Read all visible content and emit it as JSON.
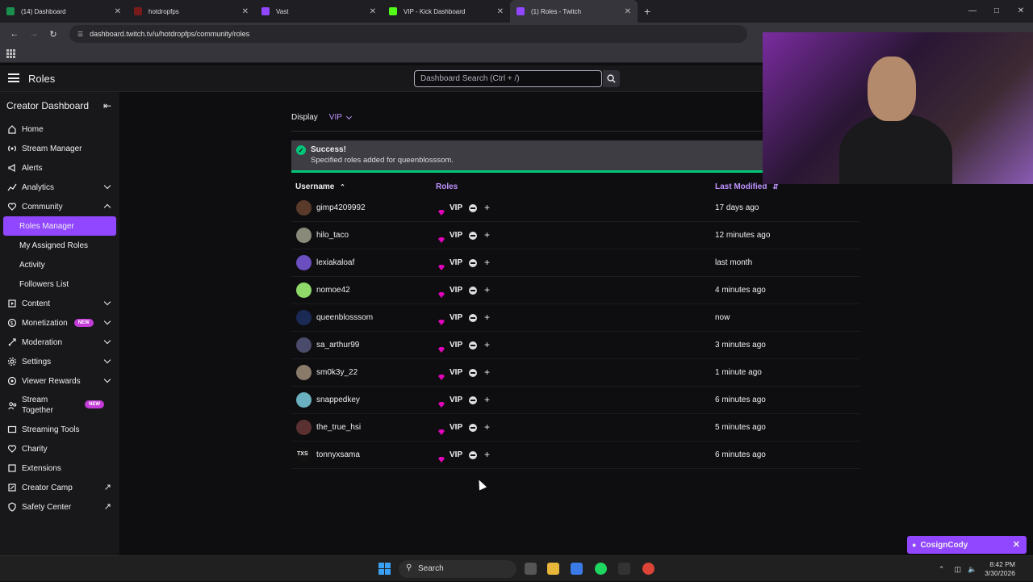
{
  "browser": {
    "tabs": [
      {
        "title": "(14) Dashboard",
        "favicon_color": "#1a8f4d",
        "active": false
      },
      {
        "title": "hotdropfps",
        "favicon_color": "#7a1b1b",
        "active": false
      },
      {
        "title": "Vast",
        "favicon_color": "#9147ff",
        "active": false
      },
      {
        "title": "VIP - Kick Dashboard",
        "favicon_color": "#53fc18",
        "active": false
      },
      {
        "title": "(1) Roles - Twitch",
        "favicon_color": "#9147ff",
        "active": true
      }
    ],
    "url": "dashboard.twitch.tv/u/hotdropfps/community/roles"
  },
  "topnav": {
    "title": "Roles",
    "search_placeholder": "Dashboard Search (Ctrl + /)"
  },
  "sidebar": {
    "header": "Creator Dashboard",
    "items": [
      {
        "label": "Home",
        "icon": "home-icon"
      },
      {
        "label": "Stream Manager",
        "icon": "broadcast-icon"
      },
      {
        "label": "Alerts",
        "icon": "megaphone-icon"
      },
      {
        "label": "Analytics",
        "icon": "chart-icon"
      },
      {
        "label": "Community",
        "icon": "heart-icon"
      }
    ],
    "community_sub": [
      {
        "label": "Roles Manager",
        "active": true
      },
      {
        "label": "My Assigned Roles",
        "active": false
      },
      {
        "label": "Activity",
        "active": false
      },
      {
        "label": "Followers List",
        "active": false
      }
    ],
    "items2": [
      {
        "label": "Content",
        "icon": "content-icon"
      },
      {
        "label": "Monetization",
        "icon": "money-icon",
        "badge": "NEW"
      },
      {
        "label": "Moderation",
        "icon": "sword-icon"
      },
      {
        "label": "Settings",
        "icon": "gear-icon"
      },
      {
        "label": "Viewer Rewards",
        "icon": "reward-icon"
      }
    ],
    "stream_together": {
      "line1": "Stream",
      "line2": "Together",
      "badge": "NEW"
    },
    "items3": [
      {
        "label": "Streaming Tools",
        "icon": "tools-icon"
      },
      {
        "label": "Charity",
        "icon": "charity-icon"
      },
      {
        "label": "Extensions",
        "icon": "puzzle-icon"
      },
      {
        "label": "Creator Camp",
        "icon": "camp-icon"
      },
      {
        "label": "Safety Center",
        "icon": "shield-icon"
      }
    ]
  },
  "main": {
    "display_label": "Display",
    "display_value": "VIP",
    "alert_title": "Success!",
    "alert_message": "Specified roles added for queenblosssom.",
    "columns": {
      "username": "Username",
      "roles": "Roles",
      "last_modified": "Last Modified"
    },
    "rows": [
      {
        "username": "gimp4209992",
        "role": "VIP",
        "modified": "17 days ago",
        "avatar": "#5a3a2a"
      },
      {
        "username": "hilo_taco",
        "role": "VIP",
        "modified": "12 minutes ago",
        "avatar": "#8a8a7a"
      },
      {
        "username": "lexiakaloaf",
        "role": "VIP",
        "modified": "last month",
        "avatar": "#6b4fbf"
      },
      {
        "username": "nomoe42",
        "role": "VIP",
        "modified": "4 minutes ago",
        "avatar": "#8fd86a"
      },
      {
        "username": "queenblosssom",
        "role": "VIP",
        "modified": "now",
        "avatar": "#1a2a55"
      },
      {
        "username": "sa_arthur99",
        "role": "VIP",
        "modified": "3 minutes ago",
        "avatar": "#4a4a6a"
      },
      {
        "username": "sm0k3y_22",
        "role": "VIP",
        "modified": "1 minute ago",
        "avatar": "#8a7a6a"
      },
      {
        "username": "snappedkey",
        "role": "VIP",
        "modified": "6 minutes ago",
        "avatar": "#6ab0c0"
      },
      {
        "username": "the_true_hsi",
        "role": "VIP",
        "modified": "5 minutes ago",
        "avatar": "#5a3030"
      },
      {
        "username": "tonnyxsama",
        "role": "VIP",
        "modified": "6 minutes ago",
        "avatar": "#111111",
        "avatar_text": "TXS"
      }
    ]
  },
  "notification": {
    "name": "CosignCody"
  },
  "taskbar": {
    "search": "Search",
    "time": "8:42 PM",
    "date": "3/30/2026"
  },
  "colors": {
    "accent": "#9147ff",
    "success": "#00c67a",
    "vip": "#e005b9",
    "link": "#bf94ff"
  }
}
